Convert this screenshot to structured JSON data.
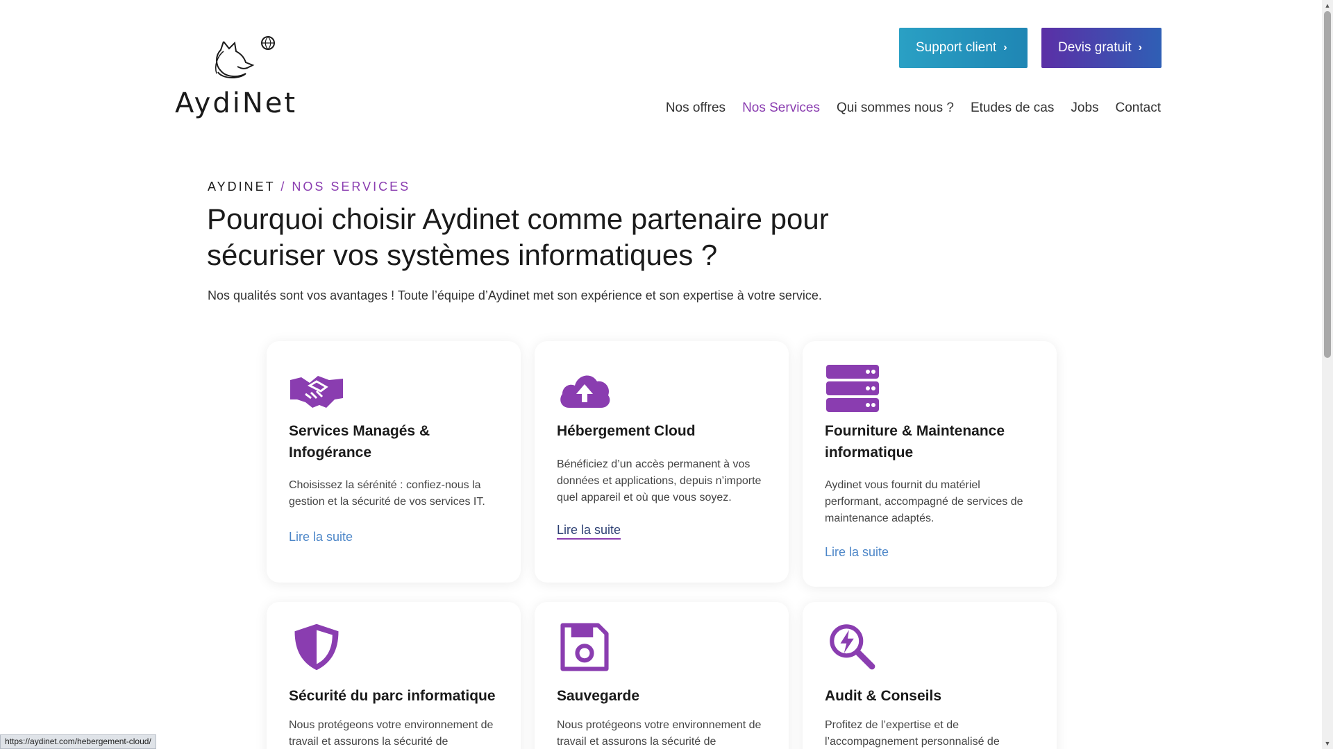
{
  "header": {
    "logo_text": "AydiNet",
    "support_button": "Support client",
    "devis_button": "Devis gratuit",
    "nav": [
      "Nos offres",
      "Nos Services",
      "Qui sommes nous ?",
      "Etudes de cas",
      "Jobs",
      "Contact"
    ],
    "active_nav": "Nos Services"
  },
  "breadcrumb": {
    "home": "AYDINET",
    "separator": "/",
    "current": "NOS SERVICES"
  },
  "title": "Pourquoi choisir Aydinet comme partenaire pour sécuriser vos systèmes informatiques ?",
  "lead": "Nos qualités sont vos avantages ! Toute l’équipe d’Aydinet met son expérience et son expertise à votre service.",
  "cards": [
    {
      "icon": "handshake-icon",
      "title": "Services Managés & Infogérance",
      "text": "Choisissez la sérénité : confiez-nous la gestion et la sécurité de vos services IT.",
      "link": "Lire la suite"
    },
    {
      "icon": "cloud-upload-icon",
      "title": "Hébergement Cloud",
      "text": "Bénéficiez d’un accès permanent à vos données et applications, depuis n’importe quel appareil et où que vous soyez.",
      "link": "Lire la suite"
    },
    {
      "icon": "server-icon",
      "title": "Fourniture & Maintenance informatique",
      "text": "Aydinet vous fournit du matériel performant, accompagné de services de maintenance adaptés.",
      "link": "Lire la suite"
    },
    {
      "icon": "shield-icon",
      "title": "Sécurité du parc informatique",
      "text": "Nous protégeons votre environnement de travail et assurons la sécurité de"
    },
    {
      "icon": "floppy-disk-icon",
      "title": "Sauvegarde",
      "text": "Nous protégeons votre environnement de travail et assurons la sécurité de"
    },
    {
      "icon": "search-bolt-icon",
      "title": "Audit & Conseils",
      "text": "Profitez de l’expertise et de l’accompagnement personnalisé de"
    }
  ],
  "status_url": "https://aydinet.com/hebergement-cloud/",
  "colors": {
    "accent": "#8a3db0",
    "support_btn": "#1f86b4",
    "devis_btn": "#5b2fa6",
    "link": "#4c86c8"
  }
}
